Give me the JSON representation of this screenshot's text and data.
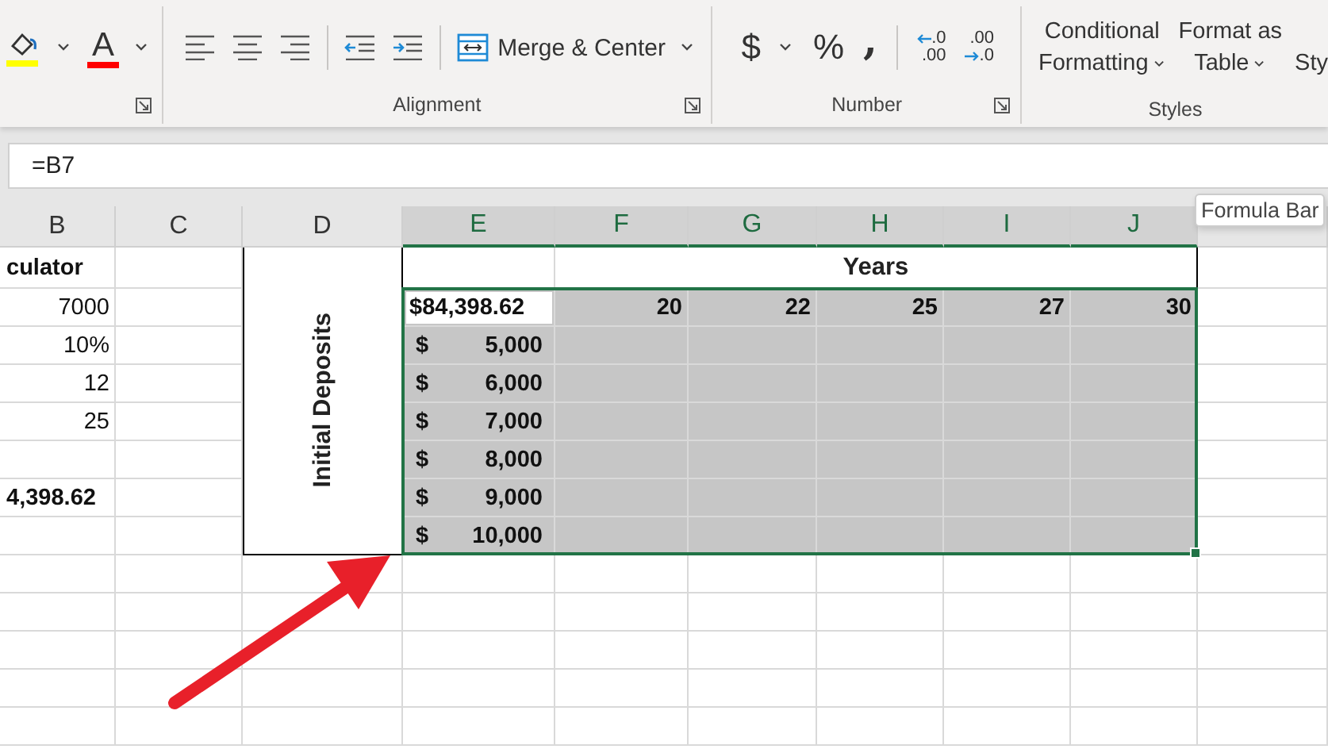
{
  "ribbon": {
    "font_buttons": [
      {
        "kind": "fill_color",
        "color": "#ffff00"
      },
      {
        "kind": "font_color",
        "glyph": "A",
        "color": "#ff0000"
      }
    ],
    "alignment": {
      "label": "Alignment",
      "merge_label": "Merge & Center"
    },
    "number": {
      "label": "Number",
      "currency": "$",
      "percent": "%",
      "comma": ",",
      "decimal_buttons": [
        {
          "kind": "decrease",
          "top": ".0",
          "bottom": ".00"
        },
        {
          "kind": "increase",
          "top": ".00",
          "bottom": ".0"
        }
      ]
    },
    "styles": {
      "label": "Styles",
      "buttons": [
        {
          "lines": [
            "Conditional",
            "Formatting"
          ],
          "dropdown": true
        },
        {
          "lines": [
            "Format as",
            "Table"
          ],
          "dropdown": true
        },
        {
          "lines": [
            "Sty"
          ],
          "dropdown": false
        }
      ]
    }
  },
  "formula_bar": {
    "value": "=B7",
    "tooltip": "Formula Bar"
  },
  "sheet": {
    "columns": [
      {
        "label": "B",
        "selected": false
      },
      {
        "label": "C",
        "selected": false
      },
      {
        "label": "D",
        "selected": false
      },
      {
        "label": "E",
        "selected": true
      },
      {
        "label": "F",
        "selected": true
      },
      {
        "label": "G",
        "selected": true
      },
      {
        "label": "H",
        "selected": true
      },
      {
        "label": "I",
        "selected": true
      },
      {
        "label": "J",
        "selected": true
      },
      {
        "selected": false
      }
    ],
    "title_fragment": "culator",
    "years_header": "Years",
    "inputs": [
      "7000",
      "10%",
      "12",
      "25"
    ],
    "result": "4,398.62",
    "row_label": "Initial Deposits",
    "active_cell": "$84,398.62",
    "years": [
      "20",
      "22",
      "25",
      "27",
      "30"
    ],
    "deposits": [
      {
        "currency": "$",
        "amount": "5,000"
      },
      {
        "currency": "$",
        "amount": "6,000"
      },
      {
        "currency": "$",
        "amount": "7,000"
      },
      {
        "currency": "$",
        "amount": "8,000"
      },
      {
        "currency": "$",
        "amount": "9,000"
      },
      {
        "currency": "$",
        "amount": "10,000"
      }
    ]
  }
}
